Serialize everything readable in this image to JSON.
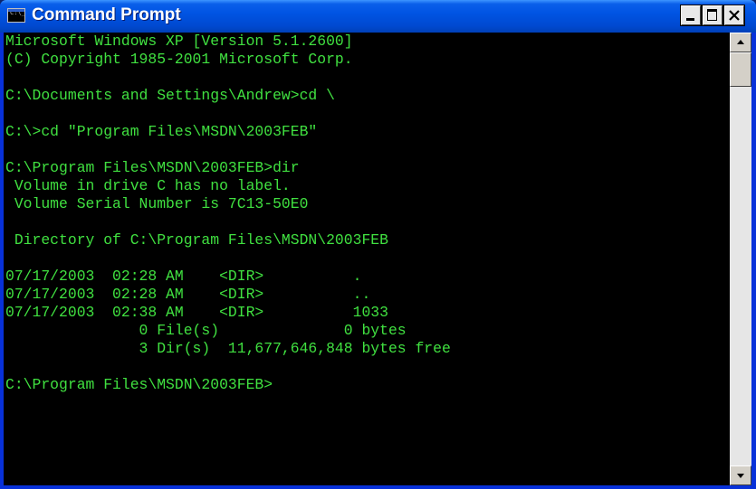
{
  "window": {
    "title": "Command Prompt",
    "icon": "console-icon",
    "icon_text": "C:\\_",
    "controls": {
      "minimize": "minimize-icon",
      "maximize": "maximize-icon",
      "close": "close-icon"
    }
  },
  "colors": {
    "titlebar": "#0054e3",
    "console_bg": "#000000",
    "console_text": "#40e040"
  },
  "console": {
    "lines": [
      "Microsoft Windows XP [Version 5.1.2600]",
      "(C) Copyright 1985-2001 Microsoft Corp.",
      "",
      "C:\\Documents and Settings\\Andrew>cd \\",
      "",
      "C:\\>cd \"Program Files\\MSDN\\2003FEB\"",
      "",
      "C:\\Program Files\\MSDN\\2003FEB>dir",
      " Volume in drive C has no label.",
      " Volume Serial Number is 7C13-50E0",
      "",
      " Directory of C:\\Program Files\\MSDN\\2003FEB",
      "",
      "07/17/2003  02:28 AM    <DIR>          .",
      "07/17/2003  02:28 AM    <DIR>          ..",
      "07/17/2003  02:38 AM    <DIR>          1033",
      "               0 File(s)              0 bytes",
      "               3 Dir(s)  11,677,646,848 bytes free",
      "",
      "C:\\Program Files\\MSDN\\2003FEB>"
    ]
  },
  "scrollbar": {
    "up": "scroll-up-arrow-icon",
    "down": "scroll-down-arrow-icon"
  }
}
